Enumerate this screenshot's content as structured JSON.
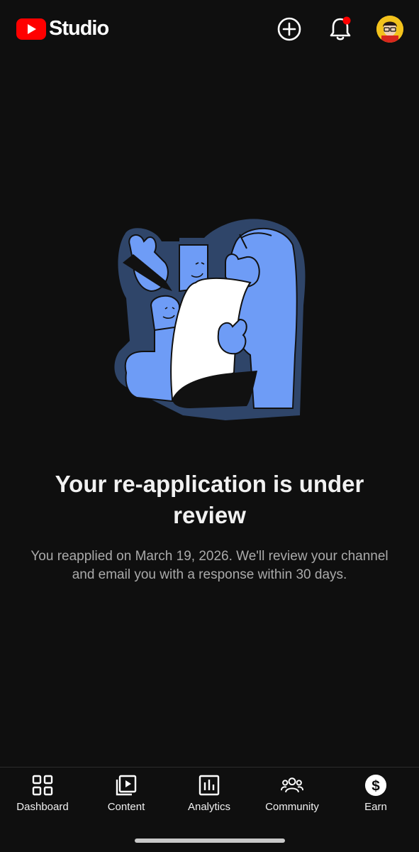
{
  "app": {
    "logo_text": "Studio",
    "logo_icon": "youtube-play-icon"
  },
  "header": {
    "create_icon": "plus-circle-icon",
    "notifications_icon": "bell-icon",
    "notification_dot_color": "#ff0000",
    "avatar_icon": "channel-avatar"
  },
  "main": {
    "illustration": "review-illustration",
    "title": "Your re-application is under review",
    "description": "You reapplied on March 19, 2026. We'll review your channel and email you with a response within 30 days."
  },
  "bottom_nav": {
    "items": [
      {
        "label": "Dashboard",
        "icon": "dashboard-icon"
      },
      {
        "label": "Content",
        "icon": "content-icon"
      },
      {
        "label": "Analytics",
        "icon": "analytics-icon"
      },
      {
        "label": "Community",
        "icon": "community-icon"
      },
      {
        "label": "Earn",
        "icon": "dollar-icon"
      }
    ]
  },
  "colors": {
    "background": "#0f0f0f",
    "brand": "#ff0000",
    "illustration_blue": "#6e9cf6",
    "illustration_outline": "#2f4569"
  }
}
